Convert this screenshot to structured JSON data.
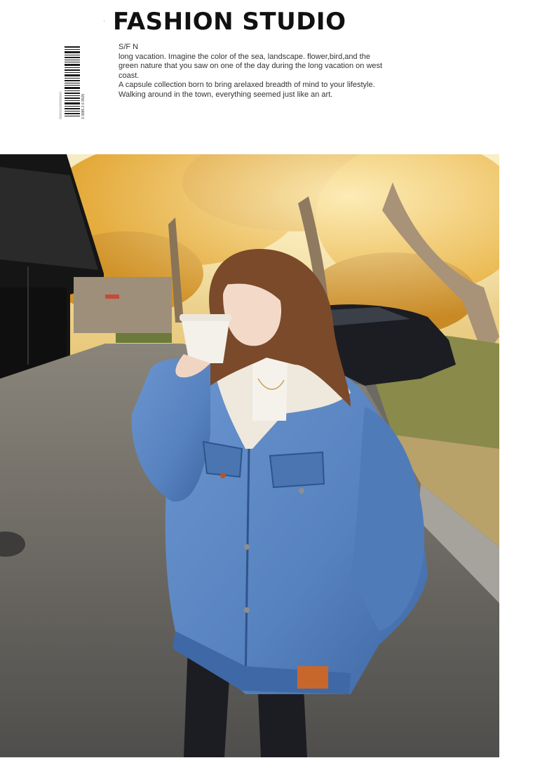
{
  "header": {
    "mark": "’",
    "title": "FASHION STUDIO",
    "code": "S/F N",
    "paragraphs": [
      "long vacation. Imagine the color of the sea, landscape. flower,bird,and the green nature that you saw on one of the day during the long vacation on west coast.",
      "A capsule collection born to bring arelaxed breadth of mind to your lifestyle.",
      "Walking around in the town, everything seemed just like an art."
    ],
    "barcode_digits": "3 3885 2 6 9505"
  },
  "photo": {
    "subject": "model-in-denim-sherpa-jacket",
    "colors": {
      "foliage": "#e3a630",
      "sky": "#f4e6b6",
      "denim": "#5b86c2",
      "denim_dark": "#3d649f",
      "sherpa": "#efe7da",
      "road": "#5e5d5a",
      "hair": "#7a4a2a",
      "label": "#c8672c"
    }
  }
}
